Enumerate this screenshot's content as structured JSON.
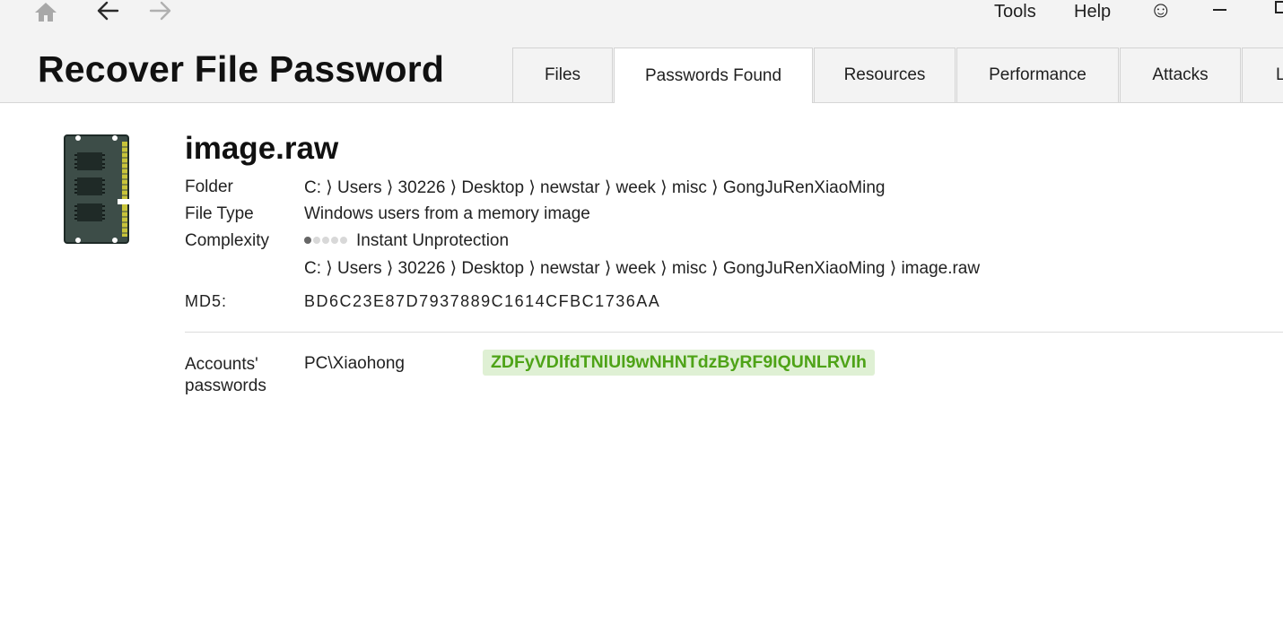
{
  "window": {
    "title": "Recover File Password",
    "menu": {
      "tools": "Tools",
      "help": "Help"
    },
    "nav_icons": [
      "home-icon",
      "back-icon",
      "forward-icon"
    ],
    "title_icons": [
      "smiley-icon",
      "minimize-icon",
      "maximize-icon"
    ]
  },
  "tabs": [
    {
      "label": "Files",
      "active": false
    },
    {
      "label": "Passwords Found",
      "active": true
    },
    {
      "label": "Resources",
      "active": false
    },
    {
      "label": "Performance",
      "active": false
    },
    {
      "label": "Attacks",
      "active": false
    },
    {
      "label": "L",
      "active": false
    }
  ],
  "file": {
    "icon": "memory-module-icon",
    "name": "image.raw",
    "folder_label": "Folder",
    "folder_path": "C: ⟩ Users ⟩ 30226 ⟩ Desktop ⟩ newstar ⟩ week ⟩ misc ⟩ GongJuRenXiaoMing",
    "type_label": "File Type",
    "type_value": "Windows users from a memory image",
    "complexity_label": "Complexity",
    "complexity_value": "Instant Unprotection",
    "complexity_level": 1,
    "complexity_max": 5,
    "full_path": "C: ⟩ Users ⟩ 30226 ⟩ Desktop ⟩ newstar ⟩ week ⟩ misc ⟩ GongJuRenXiaoMing ⟩ image.raw",
    "md5_label": "MD5:",
    "md5_value": "BD6C23E87D7937889C1614CFBC1736AA"
  },
  "accounts": {
    "label": "Accounts' passwords",
    "user": "PC\\Xiaohong",
    "password": "ZDFyVDlfdTNlUl9wNHNTdzByRF9IQUNLRVIh"
  },
  "colors": {
    "password_text": "#4ea317",
    "password_bg": "#dff0d4",
    "topbar_bg": "#f3f3f3",
    "chip_body": "#3d4d48",
    "chip_contacts": "#c8c43a"
  }
}
